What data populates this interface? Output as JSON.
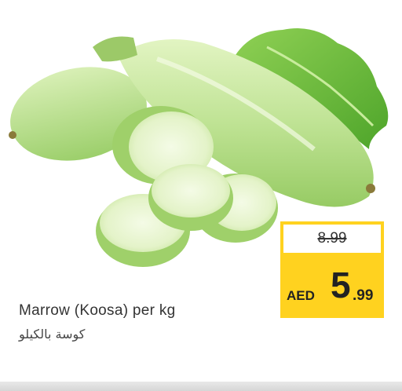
{
  "product": {
    "name": "Marrow (Koosa) per kg",
    "name_ar": "كوسة بالكيلو"
  },
  "price": {
    "old": "8.99",
    "currency": "AED",
    "integer": "5",
    "decimal": ".99"
  },
  "colors": {
    "price_box": "#ffd21f",
    "zucchini": "#b7e08a",
    "lettuce": "#6fbf3a"
  }
}
